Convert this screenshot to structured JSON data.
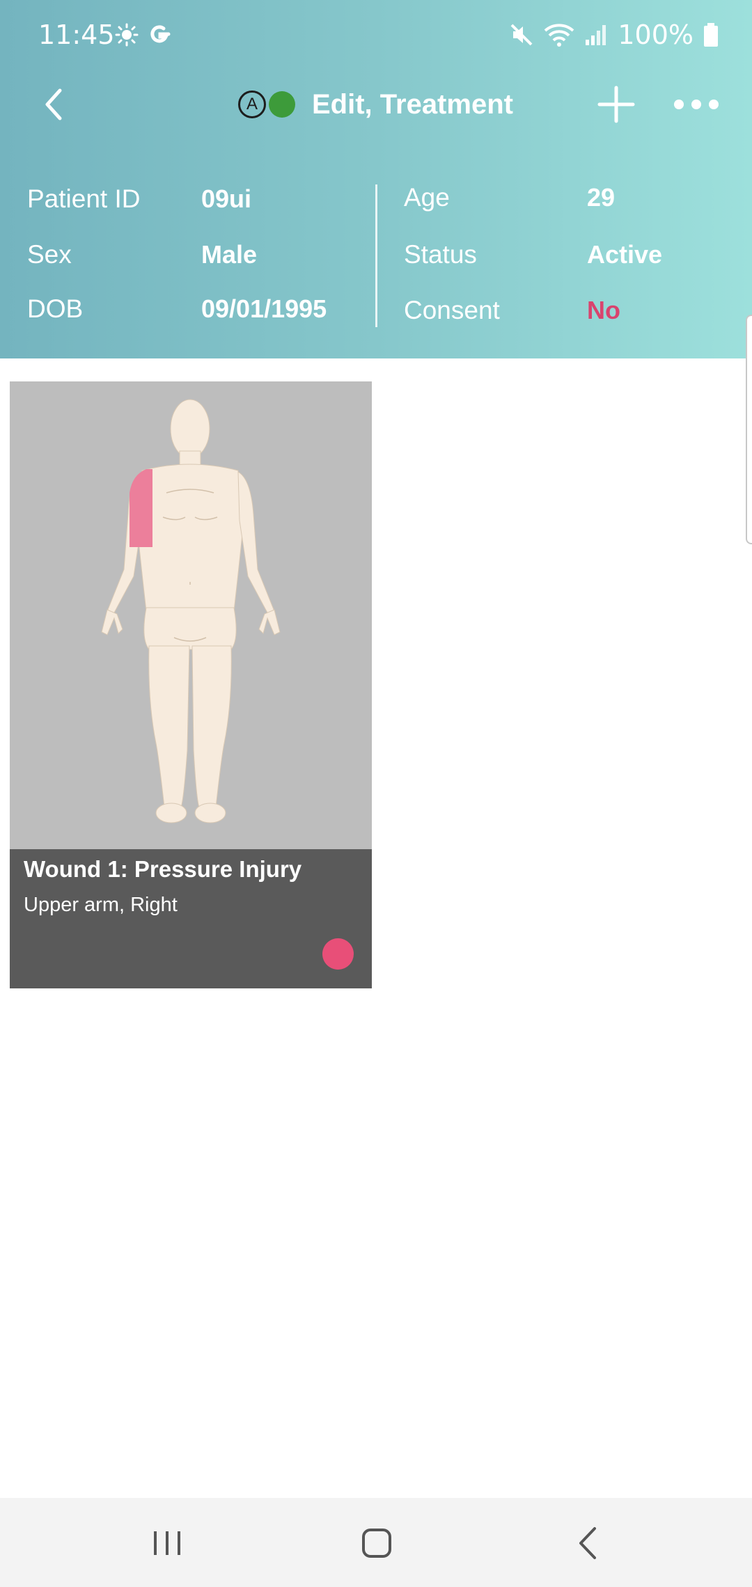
{
  "status_bar": {
    "time": "11:45",
    "battery": "100%"
  },
  "app_bar": {
    "title": "Edit, Treatment",
    "mode_badge": "A"
  },
  "patient": {
    "patient_id_label": "Patient ID",
    "patient_id_value": "09ui",
    "sex_label": "Sex",
    "sex_value": "Male",
    "dob_label": "DOB",
    "dob_value": "09/01/1995",
    "age_label": "Age",
    "age_value": "29",
    "status_label": "Status",
    "status_value": "Active",
    "consent_label": "Consent",
    "consent_value": "No"
  },
  "wound_card": {
    "title": "Wound 1: Pressure Injury",
    "location": "Upper arm, Right"
  },
  "colors": {
    "header_start": "#74b4bf",
    "header_end": "#9de0dc",
    "consent_no": "#d9436e",
    "wound_highlight": "#ec7f9b",
    "wound_dot": "#e84f78",
    "online": "#3d9b3a",
    "card_footer": "#5a5a5a"
  },
  "icons": {
    "status_left": [
      "brightness-icon",
      "google-icon"
    ],
    "status_right": [
      "mute-icon",
      "wifi-icon",
      "signal-icon",
      "battery-icon"
    ],
    "nav": [
      "recent-apps-icon",
      "home-icon",
      "back-icon"
    ]
  }
}
